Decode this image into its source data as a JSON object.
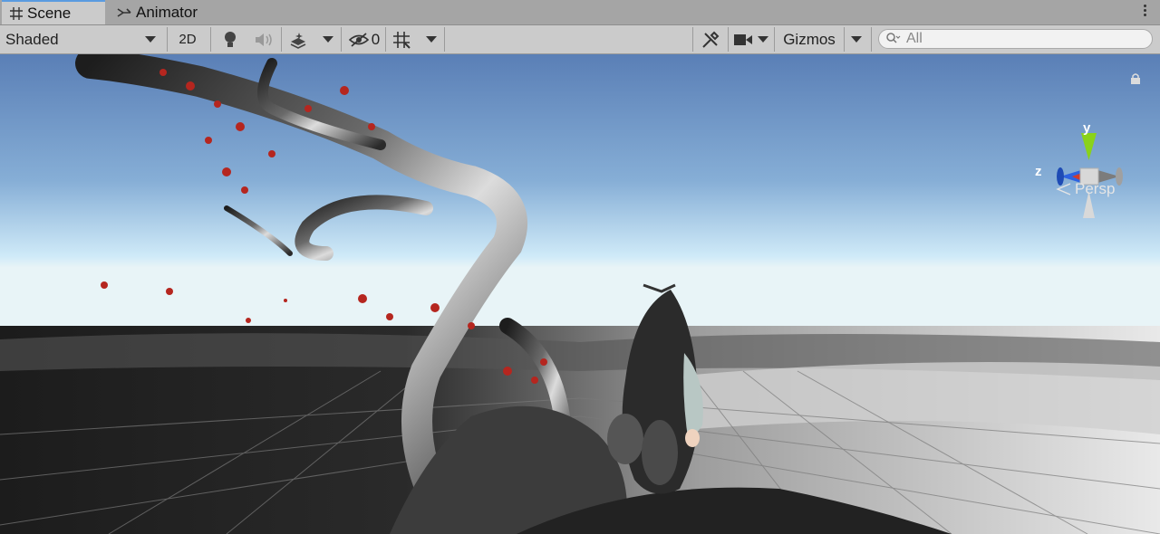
{
  "tabs": [
    {
      "label": "Scene",
      "icon": "grid-icon"
    },
    {
      "label": "Animator",
      "icon": "animator-icon"
    }
  ],
  "toolbar": {
    "draw_mode": "Shaded",
    "mode_2d": "2D",
    "hidden_count": "0",
    "gizmos_label": "Gizmos",
    "search_placeholder": "All"
  },
  "gizmo": {
    "y_label": "y",
    "z_label": "z",
    "projection": "Persp"
  },
  "colors": {
    "tab_accent": "#5a9be0",
    "axis_y": "#8ad21a",
    "axis_z": "#2d63e0",
    "axis_x": "#d23b2b",
    "sky_top": "#5f82b8",
    "sky_horizon": "#c9e6f6",
    "blossom": "#b5261f"
  }
}
